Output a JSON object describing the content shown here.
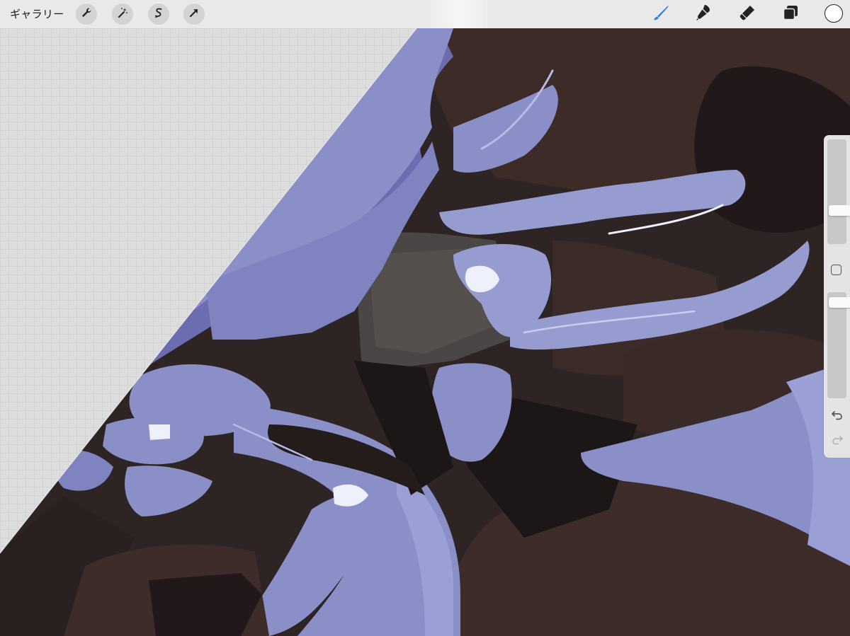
{
  "toolbar": {
    "gallery_label": "ギャラリー",
    "left_tools": [
      "wrench-icon",
      "magic-wand-icon",
      "selection-icon",
      "transform-arrow-icon"
    ],
    "right_tools": [
      "brush-icon",
      "smudge-icon",
      "eraser-icon",
      "layers-icon"
    ],
    "active_tool": "brush",
    "accent_color": "#2f7de1",
    "current_color": "#ffffff"
  },
  "sidebar": {
    "brush_size_level": 0.3,
    "opacity_level": 0.95,
    "controls": [
      "brush-size-slider",
      "modify-button",
      "opacity-slider",
      "undo-icon",
      "redo-icon"
    ]
  },
  "canvas": {
    "palette": {
      "lavender": "#8a8fc7",
      "deep_purple": "#6a6aa8",
      "dark_brown": "#3a2b2a",
      "shadow": "#1d1617",
      "grey": "#4a4645"
    }
  }
}
